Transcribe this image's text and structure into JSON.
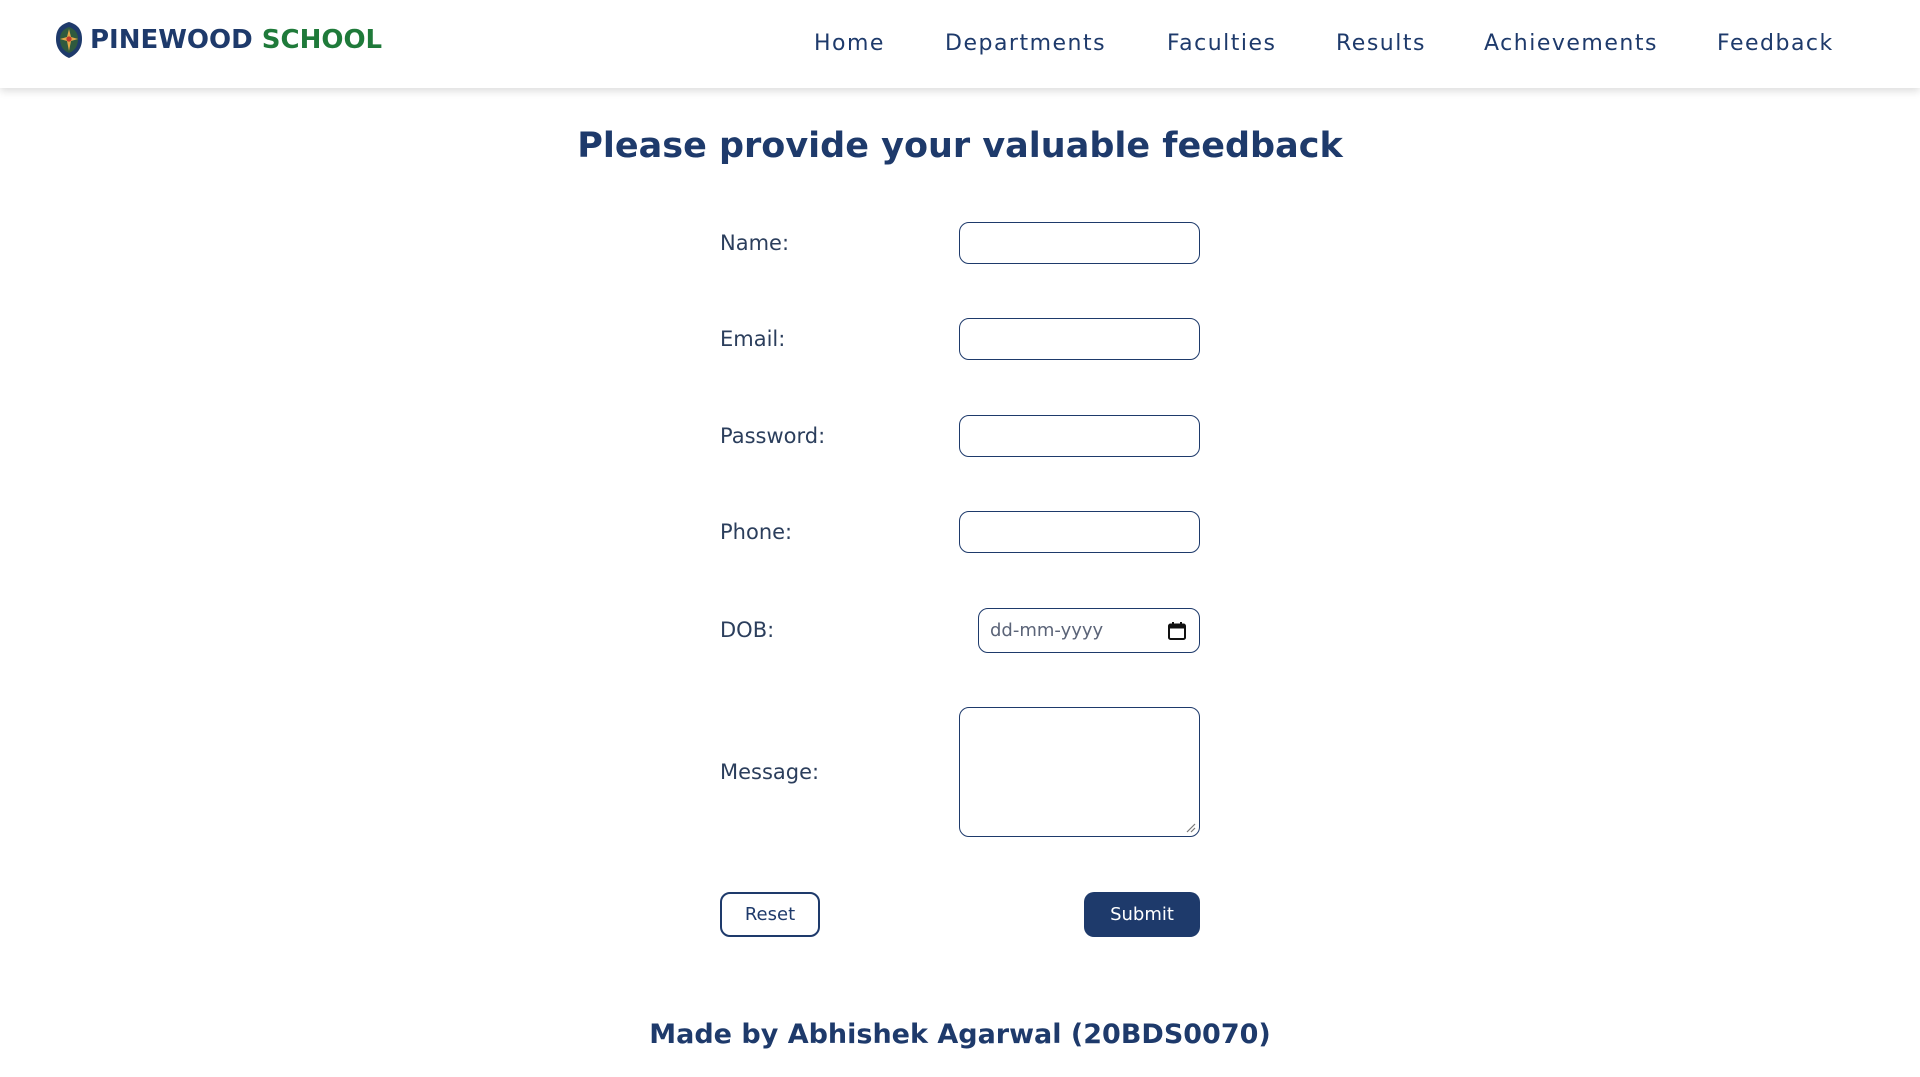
{
  "brand": {
    "name_part1": "PINEWOOD",
    "name_part2": "SCHOOL",
    "logo_icon": "school-crest-icon",
    "colors": {
      "primary": "#1e3a6b",
      "secondary": "#1f7a3a"
    }
  },
  "nav": {
    "items": [
      {
        "label": "Home"
      },
      {
        "label": "Departments"
      },
      {
        "label": "Faculties"
      },
      {
        "label": "Results"
      },
      {
        "label": "Achievements"
      },
      {
        "label": "Feedback"
      }
    ]
  },
  "form": {
    "title": "Please provide your valuable feedback",
    "fields": {
      "name": {
        "label": "Name:",
        "value": ""
      },
      "email": {
        "label": "Email:",
        "value": ""
      },
      "password": {
        "label": "Password:",
        "value": ""
      },
      "phone": {
        "label": "Phone:",
        "value": ""
      },
      "dob": {
        "label": "DOB:",
        "placeholder": "dd-mm-yyyy",
        "icon": "calendar-icon"
      },
      "message": {
        "label": "Message:",
        "value": ""
      }
    },
    "reset_label": "Reset",
    "submit_label": "Submit"
  },
  "footer": {
    "credit": "Made by Abhishek Agarwal (20BDS0070)"
  }
}
